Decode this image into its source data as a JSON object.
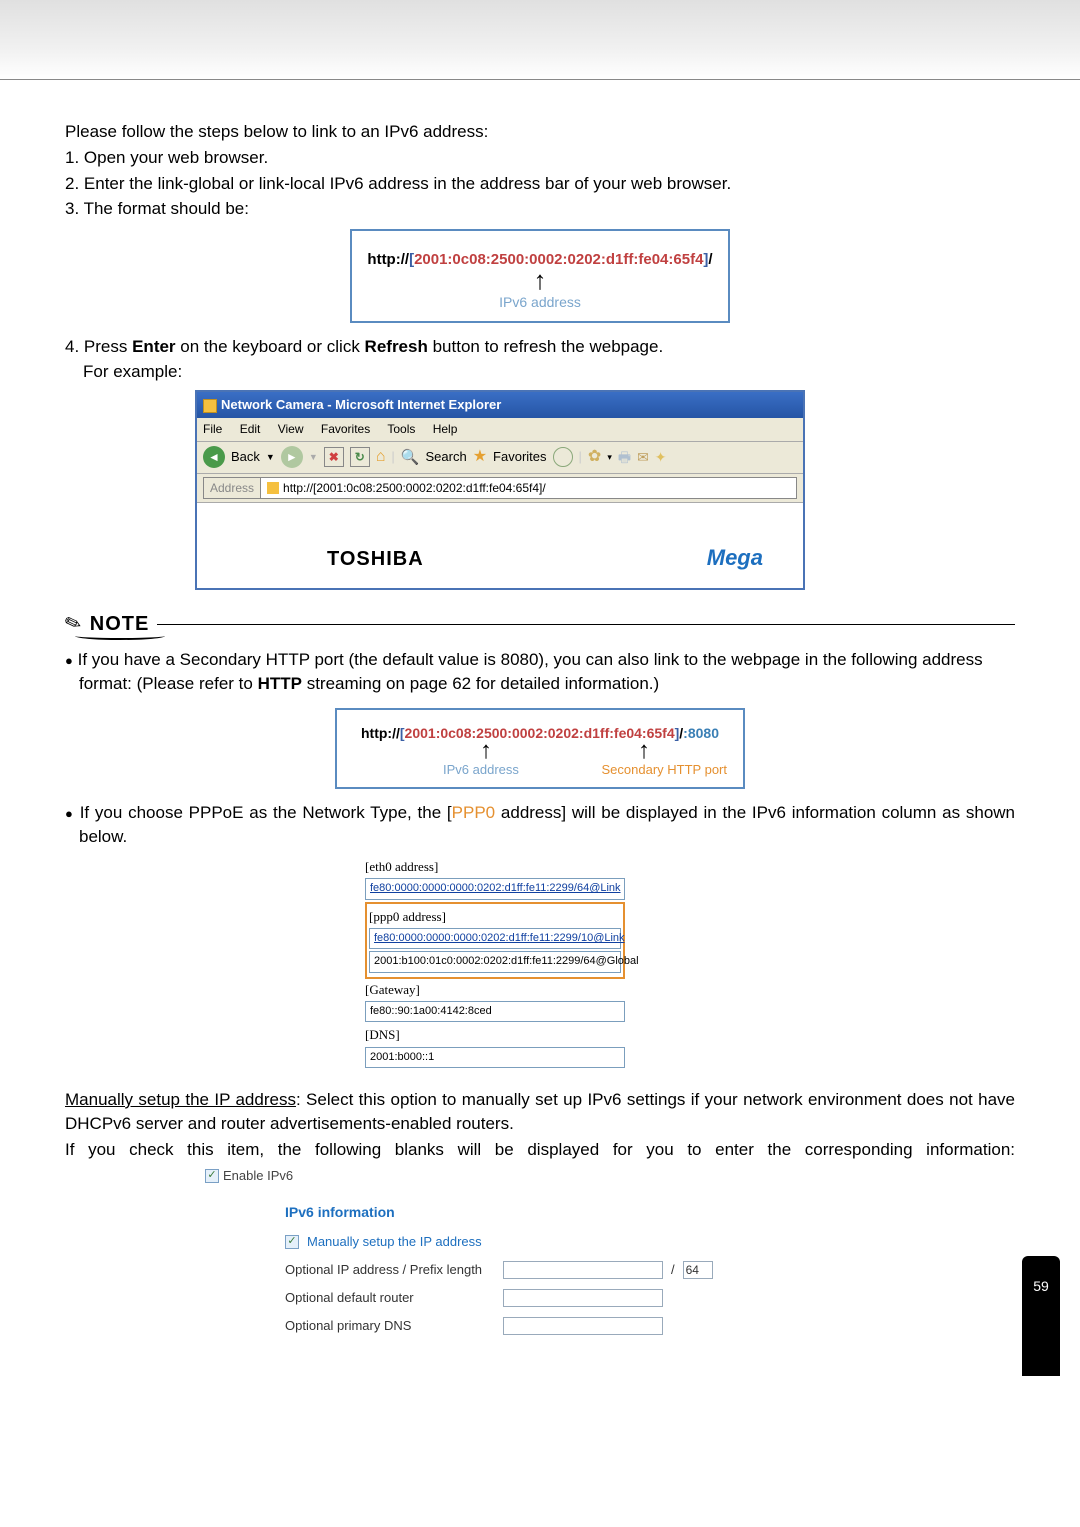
{
  "intro": "Please follow the steps below to link to an IPv6 address:",
  "steps": {
    "s1": "1. Open your web browser.",
    "s2": "2. Enter the link-global or link-local IPv6 address in the address bar of your web browser.",
    "s3": "3. The format should be:",
    "s4": {
      "pre": "4. Press ",
      "b1": "Enter",
      "mid": " on the keyboard or click ",
      "b2": "Refresh",
      "post": " button to refresh the webpage."
    },
    "ex": "For example:"
  },
  "url_box1": {
    "prefix": "http://",
    "lb": "[",
    "addr": "2001:0c08:2500:0002:0202:d1ff:fe04:65f4",
    "rb": "]",
    "suffix": "/",
    "caption": "IPv6 address"
  },
  "ie": {
    "title": "Network Camera - Microsoft Internet Explorer",
    "menu": {
      "file": "File",
      "edit": "Edit",
      "view": "View",
      "fav": "Favorites",
      "tools": "Tools",
      "help": "Help"
    },
    "toolbar": {
      "back": "Back",
      "search": "Search",
      "favorites": "Favorites"
    },
    "address_label": "Address",
    "address_value": "http://[2001:0c08:2500:0002:0202:d1ff:fe04:65f4]/",
    "brand1": "TOSHIBA",
    "brand2": "Mega"
  },
  "note_label": "NOTE",
  "note1": {
    "pre": "If you have a Secondary HTTP port (the default value is 8080), you can also link to the webpage in the following address format: (Please refer to ",
    "b": "HTTP",
    "post": " streaming on page 62 for detailed information.)"
  },
  "url_box2": {
    "prefix": "http://",
    "lb": "[",
    "addr": "2001:0c08:2500:0002:0202:d1ff:fe04:65f4",
    "rb": "]",
    "suffix": "/",
    "colon": ":",
    "port": "8080",
    "cap_left": "IPv6 address",
    "cap_right": "Secondary HTTP port"
  },
  "note2": {
    "pre": "If you choose PPPoE as the Network Type, the [",
    "ppp": "PPP0",
    "mid": " address] will be displayed in the IPv6 information column as shown below."
  },
  "v6info": {
    "eth0_label": "[eth0 address]",
    "eth0_val": "fe80:0000:0000:0000:0202:d1ff:fe11:2299/64@Link",
    "ppp0_label": "[ppp0 address]",
    "ppp0_val1": "fe80:0000:0000:0000:0202:d1ff:fe11:2299/10@Link",
    "ppp0_val2": "2001:b100:01c0:0002:0202:d1ff:fe11:2299/64@Global",
    "gw_label": "[Gateway]",
    "gw_val": "fe80::90:1a00:4142:8ced",
    "dns_label": "[DNS]",
    "dns_val": "2001:b000::1"
  },
  "manual": {
    "head": "Manually setup the IP address",
    "text1": ": Select this option to manually set up IPv6 settings if your network environment does not have DHCPv6 server and router advertisements-enabled routers.",
    "text2": "If you check this item, the following blanks will be displayed for you to enter the corresponding information:"
  },
  "form": {
    "enable": "Enable IPv6",
    "title": "IPv6 information",
    "manual": "Manually setup the IP address",
    "opt_ip": "Optional IP address / Prefix length",
    "prefix_val": "64",
    "opt_router": "Optional default router",
    "opt_dns": "Optional primary DNS"
  },
  "page_number": "59"
}
